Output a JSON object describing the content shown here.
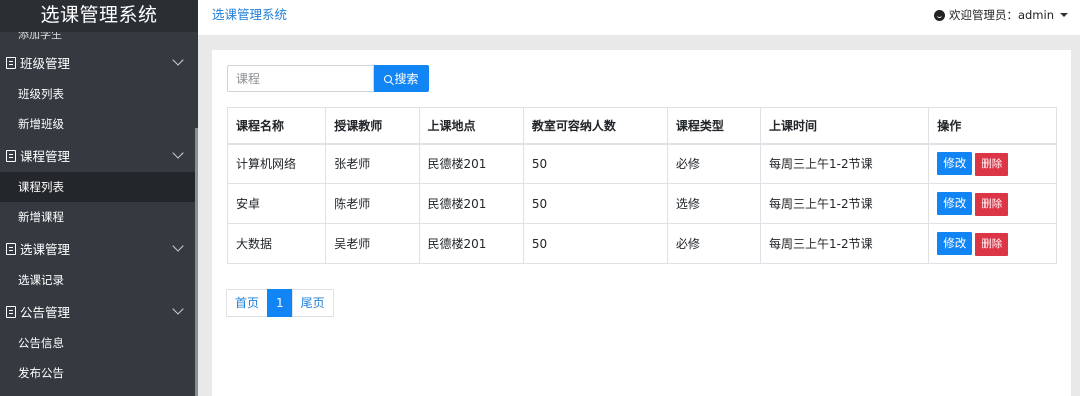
{
  "app": {
    "brand": "选课管理系统",
    "header_title": "选课管理系统",
    "user_text": "欢迎管理员：admin"
  },
  "sidebar": {
    "cut_item": "添加学生",
    "groups": [
      {
        "label": "班级管理",
        "items": [
          "班级列表",
          "新增班级"
        ]
      },
      {
        "label": "课程管理",
        "items": [
          "课程列表",
          "新增课程"
        ]
      },
      {
        "label": "选课管理",
        "items": [
          "选课记录"
        ]
      },
      {
        "label": "公告管理",
        "items": [
          "公告信息",
          "发布公告"
        ]
      }
    ]
  },
  "search": {
    "placeholder": "课程",
    "button_label": "搜索"
  },
  "table": {
    "headers": [
      "课程名称",
      "授课教师",
      "上课地点",
      "教室可容纳人数",
      "课程类型",
      "上课时间",
      "操作"
    ],
    "rows": [
      [
        "计算机网络",
        "张老师",
        "民德楼201",
        "50",
        "必修",
        "每周三上午1-2节课"
      ],
      [
        "安卓",
        "陈老师",
        "民德楼201",
        "50",
        "选修",
        "每周三上午1-2节课"
      ],
      [
        "大数据",
        "吴老师",
        "民德楼201",
        "50",
        "必修",
        "每周三上午1-2节课"
      ]
    ],
    "edit_label": "修改",
    "delete_label": "删除"
  },
  "pagination": {
    "first": "首页",
    "current": "1",
    "last": "尾页"
  }
}
